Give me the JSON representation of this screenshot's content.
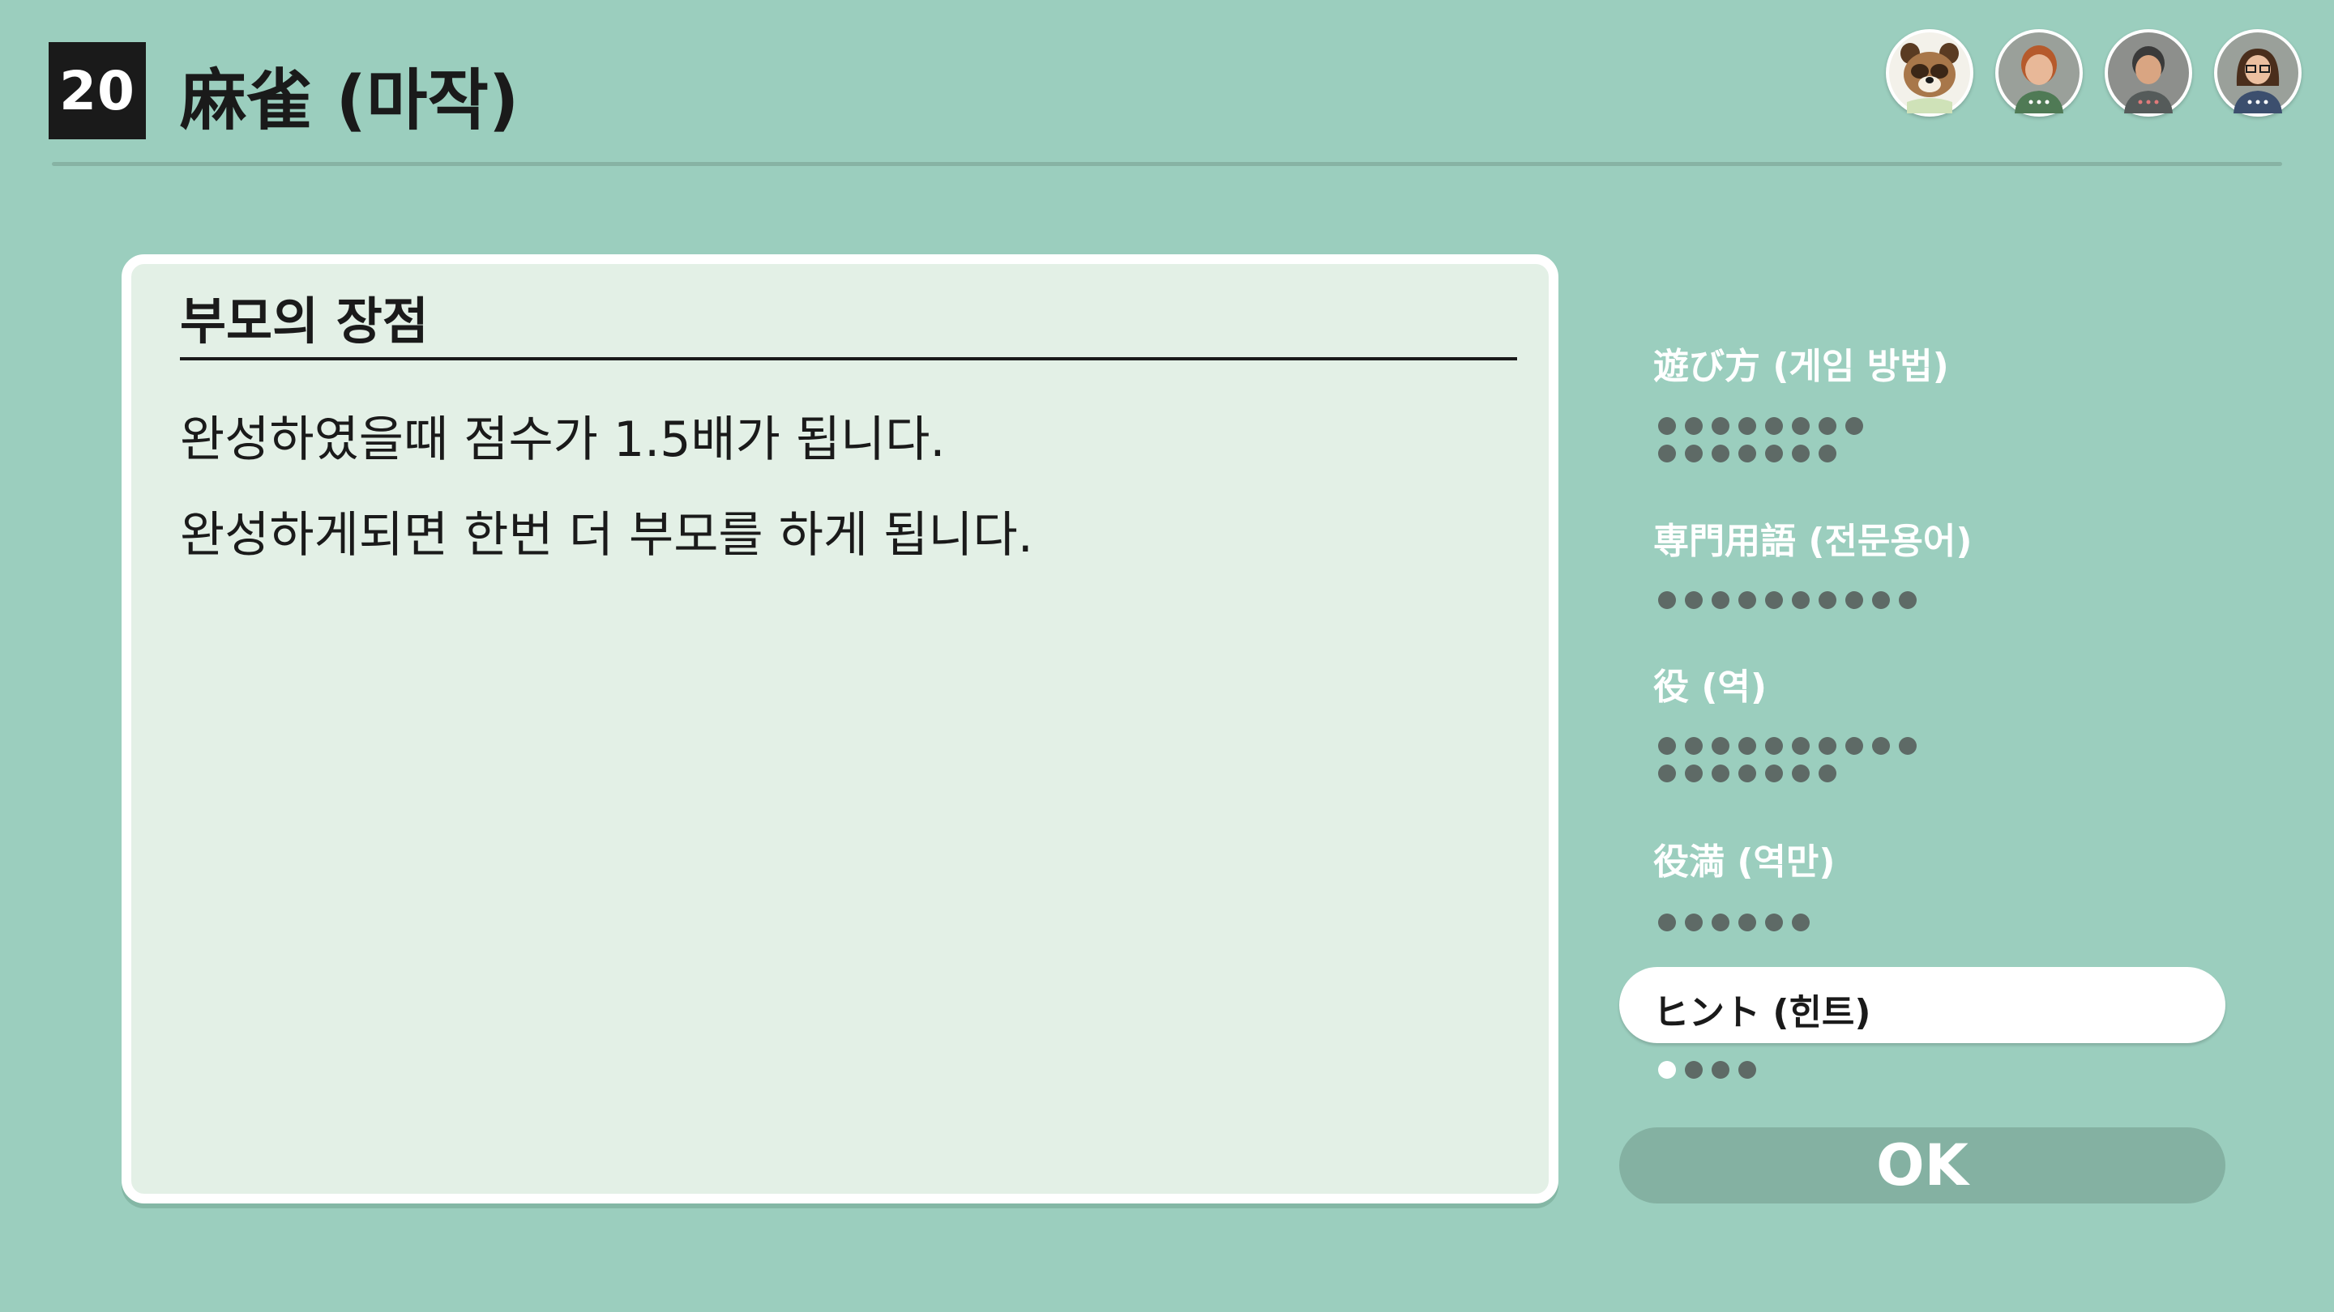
{
  "header": {
    "game_number": "20",
    "title": "麻雀 (마작)"
  },
  "players": [
    {
      "icon": "tanuki-character-avatar-icon"
    },
    {
      "icon": "red-haired-player-avatar-icon"
    },
    {
      "icon": "gray-player-avatar-icon"
    },
    {
      "icon": "glasses-player-avatar-icon"
    }
  ],
  "panel": {
    "heading": "부모의 장점",
    "lines": [
      "완성하였을때 점수가 1.5배가 됩니다.",
      "완성하게되면 한번 더 부모를 하게 됩니다."
    ]
  },
  "categories": [
    {
      "label": "遊び方 (게임 방법)",
      "pages": 15,
      "current": null,
      "selected": false
    },
    {
      "label": "専門用語 (전문용어)",
      "pages": 10,
      "current": null,
      "selected": false
    },
    {
      "label": "役 (역)",
      "pages": 17,
      "current": null,
      "selected": false
    },
    {
      "label": "役満 (역만)",
      "pages": 6,
      "current": null,
      "selected": false
    },
    {
      "label": "ヒント (힌트)",
      "pages": 4,
      "current": 1,
      "selected": true
    }
  ],
  "ok_button": {
    "label": "OK"
  },
  "colors": {
    "background": "#9bcebe",
    "panel": "#e3f0e6",
    "dot_inactive": "#5e6a66",
    "dot_active": "#ffffff",
    "ok_button": "#84b1a2"
  }
}
